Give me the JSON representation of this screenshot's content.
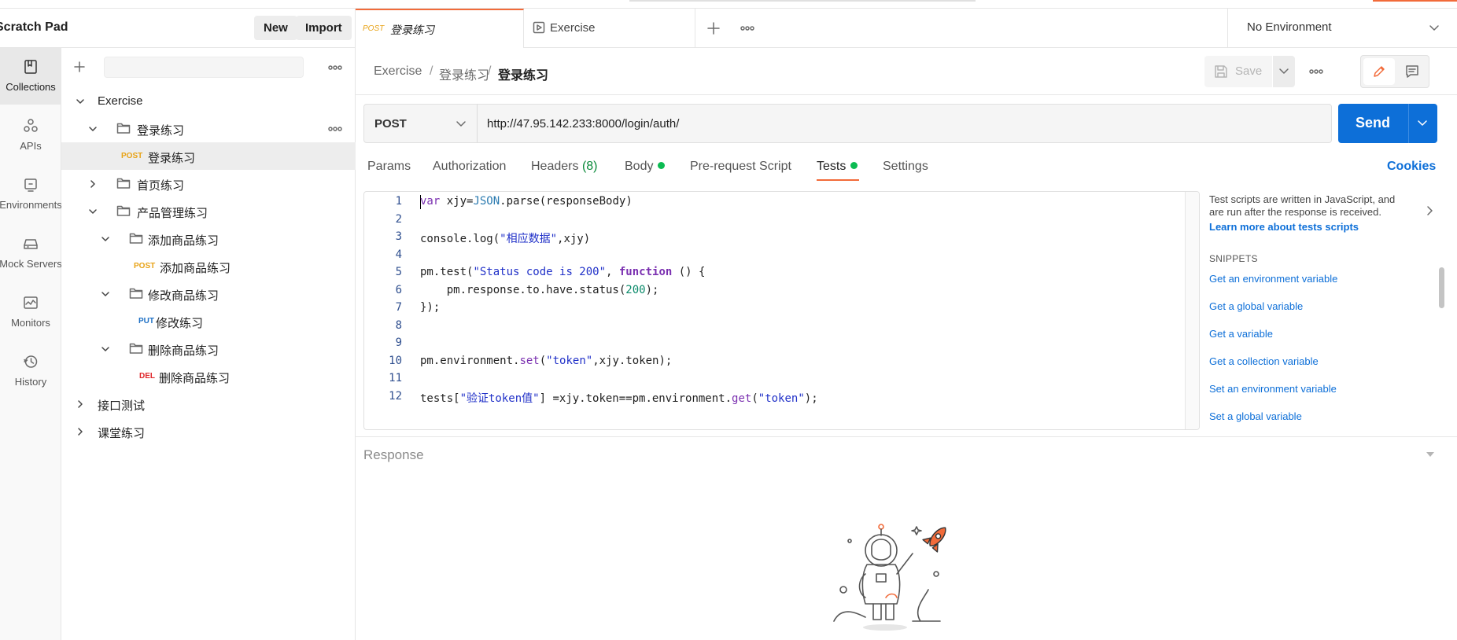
{
  "workspace": {
    "title": "Scratch Pad",
    "new_label": "New",
    "import_label": "Import"
  },
  "rail": [
    {
      "label": "Collections",
      "icon": "collections-icon",
      "active": true
    },
    {
      "label": "APIs",
      "icon": "apis-icon"
    },
    {
      "label": "Environments",
      "icon": "environments-icon"
    },
    {
      "label": "Mock Servers",
      "icon": "mock-servers-icon"
    },
    {
      "label": "Monitors",
      "icon": "monitors-icon"
    },
    {
      "label": "History",
      "icon": "history-icon"
    }
  ],
  "tree": {
    "items": [
      {
        "label": "Exercise"
      },
      {
        "label": "登录练习"
      },
      {
        "method": "POST",
        "label": "登录练习"
      },
      {
        "label": "首页练习"
      },
      {
        "label": "产品管理练习"
      },
      {
        "label": "添加商品练习"
      },
      {
        "method": "POST",
        "label": "添加商品练习"
      },
      {
        "label": "修改商品练习"
      },
      {
        "method": "PUT",
        "label": "修改练习"
      },
      {
        "label": "删除商品练习"
      },
      {
        "method": "DEL",
        "label": "删除商品练习"
      },
      {
        "label": "接口测试"
      },
      {
        "label": "课堂练习"
      }
    ]
  },
  "tabs": [
    {
      "method": "POST",
      "label": "登录练习"
    },
    {
      "label": "Exercise"
    }
  ],
  "environment": {
    "label": "No Environment"
  },
  "breadcrumb": {
    "part1": "Exercise",
    "sep": "/",
    "part2": "登录练习",
    "current": "登录练习"
  },
  "actions": {
    "save_label": "Save"
  },
  "request": {
    "method": "POST",
    "url": "http://47.95.142.233:8000/login/auth/",
    "send_label": "Send"
  },
  "request_tabs": {
    "params": "Params",
    "authorization": "Authorization",
    "headers": "Headers",
    "headers_count": "(8)",
    "body": "Body",
    "prerequest": "Pre-request Script",
    "tests": "Tests",
    "settings": "Settings",
    "cookies": "Cookies"
  },
  "editor": {
    "line_numbers": [
      "1",
      "2",
      "3",
      "4",
      "5",
      "6",
      "7",
      "8",
      "9",
      "10",
      "11",
      "12"
    ]
  },
  "snippets": {
    "intro1": "Test scripts are written in JavaScript, and",
    "intro2": "are run after the response is received.",
    "learn_more": "Learn more about tests scripts",
    "heading": "SNIPPETS",
    "items": [
      "Get an environment variable",
      "Get a global variable",
      "Get a variable",
      "Get a collection variable",
      "Set an environment variable",
      "Set a global variable"
    ]
  },
  "response": {
    "label": "Response"
  },
  "colors": {
    "accent": "#f26b3a",
    "primary": "#0d6fd8",
    "post": "#e8a317",
    "put": "#1e70c5",
    "del": "#e0282c",
    "dot": "#0cbb52"
  }
}
